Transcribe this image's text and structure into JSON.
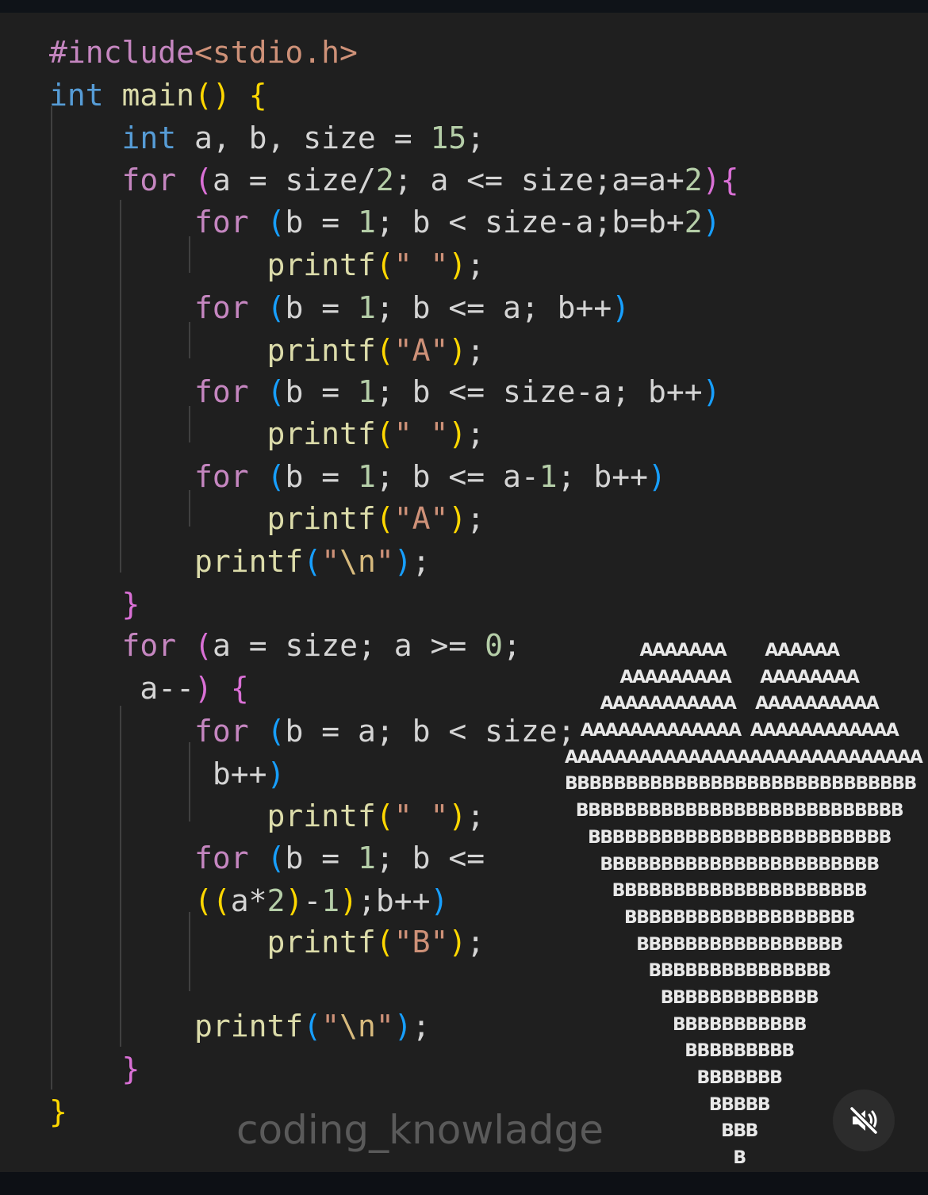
{
  "code_lines": [
    [
      [
        "pre",
        "#include"
      ],
      [
        "inc",
        "<stdio.h>"
      ]
    ],
    [
      [
        "kw",
        "int"
      ],
      [
        "var",
        " "
      ],
      [
        "fn",
        "main"
      ],
      [
        "b1",
        "()"
      ],
      [
        "var",
        " "
      ],
      [
        "b1",
        "{"
      ]
    ],
    [
      [
        "var",
        "    "
      ],
      [
        "kw",
        "int"
      ],
      [
        "var",
        " a, b, size = "
      ],
      [
        "num",
        "15"
      ],
      [
        "var",
        ";"
      ]
    ],
    [
      [
        "var",
        "    "
      ],
      [
        "ctl",
        "for"
      ],
      [
        "var",
        " "
      ],
      [
        "b2",
        "("
      ],
      [
        "var",
        "a = size/"
      ],
      [
        "num",
        "2"
      ],
      [
        "var",
        "; a <= size;a=a+"
      ],
      [
        "num",
        "2"
      ],
      [
        "b2",
        ")"
      ],
      [
        "b2",
        "{"
      ]
    ],
    [
      [
        "var",
        "        "
      ],
      [
        "ctl",
        "for"
      ],
      [
        "var",
        " "
      ],
      [
        "b3",
        "("
      ],
      [
        "var",
        "b = "
      ],
      [
        "num",
        "1"
      ],
      [
        "var",
        "; b < size-a;b=b+"
      ],
      [
        "num",
        "2"
      ],
      [
        "b3",
        ")"
      ]
    ],
    [
      [
        "var",
        "            "
      ],
      [
        "fn",
        "printf"
      ],
      [
        "b1",
        "("
      ],
      [
        "str",
        "\" \""
      ],
      [
        "b1",
        ")"
      ],
      [
        "var",
        ";"
      ]
    ],
    [
      [
        "var",
        "        "
      ],
      [
        "ctl",
        "for"
      ],
      [
        "var",
        " "
      ],
      [
        "b3",
        "("
      ],
      [
        "var",
        "b = "
      ],
      [
        "num",
        "1"
      ],
      [
        "var",
        "; b <= a; b++"
      ],
      [
        "b3",
        ")"
      ]
    ],
    [
      [
        "var",
        "            "
      ],
      [
        "fn",
        "printf"
      ],
      [
        "b1",
        "("
      ],
      [
        "str",
        "\"A\""
      ],
      [
        "b1",
        ")"
      ],
      [
        "var",
        ";"
      ]
    ],
    [
      [
        "var",
        "        "
      ],
      [
        "ctl",
        "for"
      ],
      [
        "var",
        " "
      ],
      [
        "b3",
        "("
      ],
      [
        "var",
        "b = "
      ],
      [
        "num",
        "1"
      ],
      [
        "var",
        "; b <= size-a; b++"
      ],
      [
        "b3",
        ")"
      ]
    ],
    [
      [
        "var",
        "            "
      ],
      [
        "fn",
        "printf"
      ],
      [
        "b1",
        "("
      ],
      [
        "str",
        "\" \""
      ],
      [
        "b1",
        ")"
      ],
      [
        "var",
        ";"
      ]
    ],
    [
      [
        "var",
        "        "
      ],
      [
        "ctl",
        "for"
      ],
      [
        "var",
        " "
      ],
      [
        "b3",
        "("
      ],
      [
        "var",
        "b = "
      ],
      [
        "num",
        "1"
      ],
      [
        "var",
        "; b <= a-"
      ],
      [
        "num",
        "1"
      ],
      [
        "var",
        "; b++"
      ],
      [
        "b3",
        ")"
      ]
    ],
    [
      [
        "var",
        "            "
      ],
      [
        "fn",
        "printf"
      ],
      [
        "b1",
        "("
      ],
      [
        "str",
        "\"A\""
      ],
      [
        "b1",
        ")"
      ],
      [
        "var",
        ";"
      ]
    ],
    [
      [
        "var",
        "        "
      ],
      [
        "fn",
        "printf"
      ],
      [
        "b3",
        "("
      ],
      [
        "str",
        "\""
      ],
      [
        "esc",
        "\\n"
      ],
      [
        "str",
        "\""
      ],
      [
        "b3",
        ")"
      ],
      [
        "var",
        ";"
      ]
    ],
    [
      [
        "var",
        "    "
      ],
      [
        "b2",
        "}"
      ]
    ],
    [
      [
        "var",
        "    "
      ],
      [
        "ctl",
        "for"
      ],
      [
        "var",
        " "
      ],
      [
        "b2",
        "("
      ],
      [
        "var",
        "a = size; a >= "
      ],
      [
        "num",
        "0"
      ],
      [
        "var",
        ";"
      ]
    ],
    [
      [
        "var",
        "     a--"
      ],
      [
        "b2",
        ")"
      ],
      [
        "var",
        " "
      ],
      [
        "b2",
        "{"
      ]
    ],
    [
      [
        "var",
        "        "
      ],
      [
        "ctl",
        "for"
      ],
      [
        "var",
        " "
      ],
      [
        "b3",
        "("
      ],
      [
        "var",
        "b = a; b < size;"
      ]
    ],
    [
      [
        "var",
        "         b++"
      ],
      [
        "b3",
        ")"
      ]
    ],
    [
      [
        "var",
        "            "
      ],
      [
        "fn",
        "printf"
      ],
      [
        "b1",
        "("
      ],
      [
        "str",
        "\" \""
      ],
      [
        "b1",
        ")"
      ],
      [
        "var",
        ";"
      ]
    ],
    [
      [
        "var",
        "        "
      ],
      [
        "ctl",
        "for"
      ],
      [
        "var",
        " "
      ],
      [
        "b3",
        "("
      ],
      [
        "var",
        "b = "
      ],
      [
        "num",
        "1"
      ],
      [
        "var",
        "; b <="
      ]
    ],
    [
      [
        "var",
        "        "
      ],
      [
        "b1",
        "(("
      ],
      [
        "var",
        "a*"
      ],
      [
        "num",
        "2"
      ],
      [
        "b1",
        ")"
      ],
      [
        "var",
        "-"
      ],
      [
        "num",
        "1"
      ],
      [
        "b1",
        ")"
      ],
      [
        "var",
        ";b++"
      ],
      [
        "b3",
        ")"
      ]
    ],
    [
      [
        "var",
        "            "
      ],
      [
        "fn",
        "printf"
      ],
      [
        "b1",
        "("
      ],
      [
        "str",
        "\"B\""
      ],
      [
        "b1",
        ")"
      ],
      [
        "var",
        ";"
      ]
    ],
    [
      [
        "var",
        ""
      ]
    ],
    [
      [
        "var",
        "        "
      ],
      [
        "fn",
        "printf"
      ],
      [
        "b3",
        "("
      ],
      [
        "str",
        "\""
      ],
      [
        "esc",
        "\\n"
      ],
      [
        "str",
        "\""
      ],
      [
        "b3",
        ")"
      ],
      [
        "var",
        ";"
      ]
    ],
    [
      [
        "var",
        "    "
      ],
      [
        "b2",
        "}"
      ]
    ],
    [
      [
        "b1",
        "}"
      ]
    ]
  ],
  "pattern_lines": [
    "AAAAAAA        AAAAAA",
    "AAAAAAAAA      AAAAAAAA",
    "AAAAAAAAAAA    AAAAAAAAAA",
    "AAAAAAAAAAAAA  AAAAAAAAAAAA",
    "AAAAAAAAAAAAAAAAAAAAAAAAAAAAA",
    "BBBBBBBBBBBBBBBBBBBBBBBBBBBBB",
    "BBBBBBBBBBBBBBBBBBBBBBBBBBB",
    "BBBBBBBBBBBBBBBBBBBBBBBBB",
    "BBBBBBBBBBBBBBBBBBBBBBB",
    "BBBBBBBBBBBBBBBBBBBBB",
    "BBBBBBBBBBBBBBBBBBB",
    "BBBBBBBBBBBBBBBBB",
    "BBBBBBBBBBBBBBB",
    "BBBBBBBBBBBBB",
    "BBBBBBBBBBB",
    "BBBBBBBBB",
    "BBBBBBB",
    "BBBBB",
    "BBB",
    "B"
  ],
  "watermark": "coding_knowladge",
  "icons": {
    "mute": "muted-speaker-icon"
  }
}
